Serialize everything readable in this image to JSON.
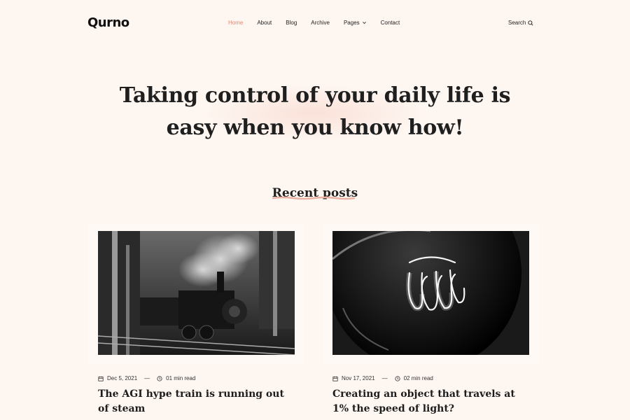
{
  "header": {
    "logo": "Qurno",
    "nav": [
      {
        "label": "Home",
        "active": true
      },
      {
        "label": "About"
      },
      {
        "label": "Blog"
      },
      {
        "label": "Archive"
      },
      {
        "label": "Pages",
        "dropdown": true
      },
      {
        "label": "Contact"
      }
    ],
    "search_label": "Search"
  },
  "hero": {
    "title": "Taking control of your daily life is easy when you know how!"
  },
  "recent": {
    "title": "Recent posts",
    "posts": [
      {
        "date": "Dec 5, 2021",
        "read_time": "01 min read",
        "title": "The AGI hype train is running out of steam",
        "image": "steam-train-photo"
      },
      {
        "date": "Nov 17, 2021",
        "read_time": "02 min read",
        "title": "Creating an object that travels at 1% the speed of light?",
        "image": "light-bulb-photo"
      }
    ]
  },
  "colors": {
    "background": "#fef6f1",
    "accent": "#e7876e",
    "text": "#1d1d1d"
  }
}
